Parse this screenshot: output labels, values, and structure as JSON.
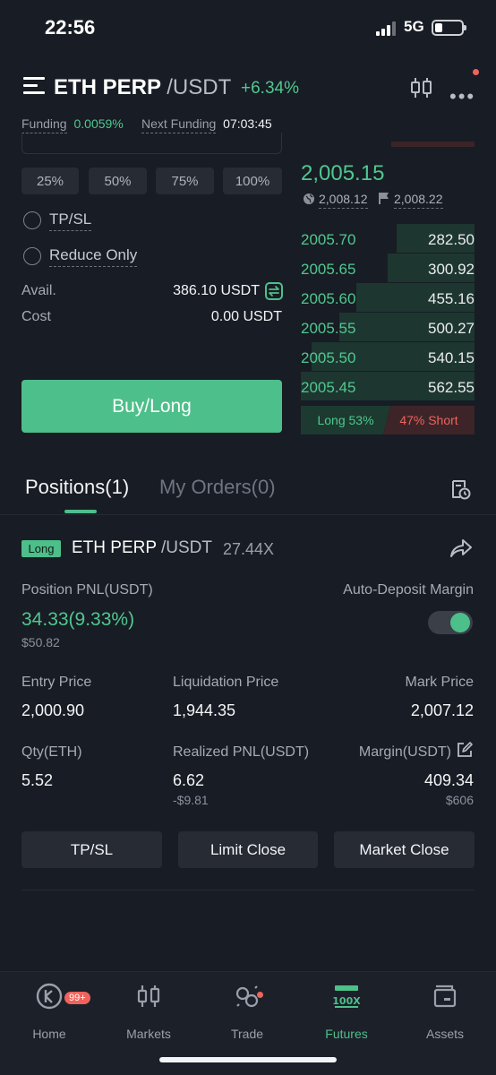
{
  "status": {
    "time": "22:56",
    "network": "5G"
  },
  "header": {
    "symbol": "ETH PERP",
    "quote": "/USDT",
    "change": "+6.34%"
  },
  "funding": {
    "label": "Funding",
    "rate": "0.0059%",
    "next_label": "Next Funding",
    "countdown": "07:03:45"
  },
  "order_form": {
    "percents": [
      "25%",
      "50%",
      "75%",
      "100%"
    ],
    "tpsl_label": "TP/SL",
    "reduce_only_label": "Reduce Only",
    "avail_label": "Avail.",
    "avail_value": "386.10 USDT",
    "cost_label": "Cost",
    "cost_value": "0.00 USDT",
    "buy_label": "Buy/Long"
  },
  "order_book": {
    "last_price": "2,005.15",
    "index_price": "2,008.12",
    "mark_price": "2,008.22",
    "bids": [
      {
        "price": "2005.70",
        "qty": "282.50",
        "depth": 0.45
      },
      {
        "price": "2005.65",
        "qty": "300.92",
        "depth": 0.5
      },
      {
        "price": "2005.60",
        "qty": "455.16",
        "depth": 0.68
      },
      {
        "price": "2005.55",
        "qty": "500.27",
        "depth": 0.78
      },
      {
        "price": "2005.50",
        "qty": "540.15",
        "depth": 0.94
      },
      {
        "price": "2005.45",
        "qty": "562.55",
        "depth": 1.0
      }
    ],
    "long_ratio": "Long 53%",
    "short_ratio": "47% Short",
    "colors": {
      "bid": "#4fc88f",
      "ask": "#f0635c"
    }
  },
  "tabs": [
    {
      "label": "Positions(1)",
      "active": true
    },
    {
      "label": "My Orders(0)",
      "active": false
    }
  ],
  "position": {
    "side": "Long",
    "symbol": "ETH PERP",
    "quote": "/USDT",
    "leverage": "27.44X",
    "pnl_label": "Position PNL(USDT)",
    "pnl_value": "34.33(9.33%)",
    "pnl_usd": "$50.82",
    "auto_deposit_label": "Auto-Deposit Margin",
    "auto_deposit_on": true,
    "entry_label": "Entry Price",
    "entry_value": "2,000.90",
    "liq_label": "Liquidation Price",
    "liq_value": "1,944.35",
    "mark_label": "Mark Price",
    "mark_value": "2,007.12",
    "qty_label": "Qty(ETH)",
    "qty_value": "5.52",
    "realized_label": "Realized PNL(USDT)",
    "realized_value": "6.62",
    "realized_usd": "-$9.81",
    "margin_label": "Margin(USDT)",
    "margin_value": "409.34",
    "margin_usd": "$606",
    "buttons": [
      "TP/SL",
      "Limit Close",
      "Market Close"
    ]
  },
  "nav": {
    "items": [
      {
        "label": "Home",
        "icon": "home-logo-icon",
        "badge": "99+"
      },
      {
        "label": "Markets",
        "icon": "candlestick-icon"
      },
      {
        "label": "Trade",
        "icon": "trade-swap-icon"
      },
      {
        "label": "Futures",
        "icon": "futures-100x-icon",
        "active": true
      },
      {
        "label": "Assets",
        "icon": "wallet-icon"
      }
    ]
  }
}
